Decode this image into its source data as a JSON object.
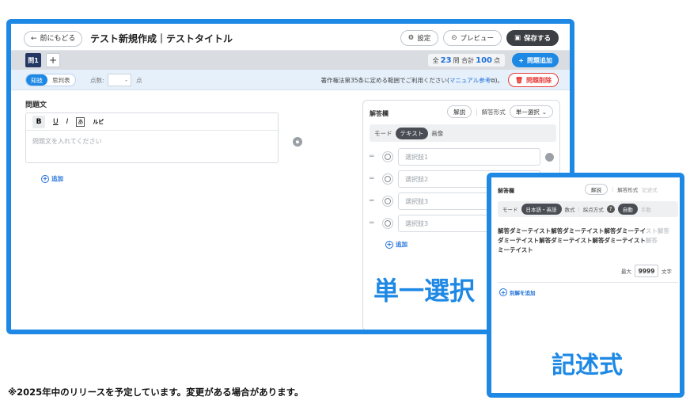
{
  "topbar": {
    "back_label": "前にもどる",
    "title": "テスト新規作成｜テストタイトル",
    "settings_label": "設定",
    "preview_label": "プレビュー",
    "save_label": "保存する"
  },
  "tabs": {
    "current": "問1",
    "add": "+"
  },
  "summary": {
    "prefix": "全",
    "question_count": "23",
    "mid": "問 合計",
    "total_points": "100",
    "suffix": "点"
  },
  "add_question_label": "問題追加",
  "settings": {
    "mode_options": [
      "知技",
      "思判表"
    ],
    "score_label": "点数:",
    "score_value": "-",
    "score_unit": "点",
    "copyright_text": "著作権法第35条に定める範囲でご利用ください(",
    "copyright_link": "マニュアル参考",
    "copyright_end": ")。",
    "delete_label": "問題削除"
  },
  "question": {
    "label": "問題文",
    "toolbar": [
      "B",
      "U",
      "I",
      "あ",
      "ルビ"
    ],
    "placeholder": "問題文を入れてください",
    "add_label": "追加"
  },
  "answer_panel": {
    "title": "解答欄",
    "explain_label": "解説",
    "format_label": "解答形式",
    "format_value": "単一選択",
    "mode_label": "モード",
    "modes": [
      "テキスト",
      "画像"
    ],
    "choices": [
      "選択肢1",
      "選択肢2",
      "選択肢3",
      "選択肢3"
    ],
    "add_label": "追加"
  },
  "labels": {
    "single_choice": "単一選択",
    "descriptive": "記述式"
  },
  "overlay": {
    "title": "解答欄",
    "explain_label": "解説",
    "format_label": "解答形式",
    "format_value": "記述式",
    "mode_label": "モード",
    "modes": [
      "日本語・英語",
      "数式"
    ],
    "scoring_label": "採点方式",
    "scoring_options": [
      "自動",
      "手動"
    ],
    "answer_text_visible": "解答ダミーテイスト解答ダミーテイスト解答ダミーテイ",
    "answer_text_fade": "スト解答",
    "answer_text_line2": "ダミーテイスト解答ダミーテイスト解答ダミーテイスト",
    "answer_text_line2_fade": "解答",
    "answer_text_line3": "ミーテイスト",
    "max_label": "最大",
    "max_value": "9999",
    "max_unit": "文字",
    "add_alt_label": "別解を追加"
  },
  "footnote": "※2025年中のリリースを予定しています。変更がある場合があります。"
}
